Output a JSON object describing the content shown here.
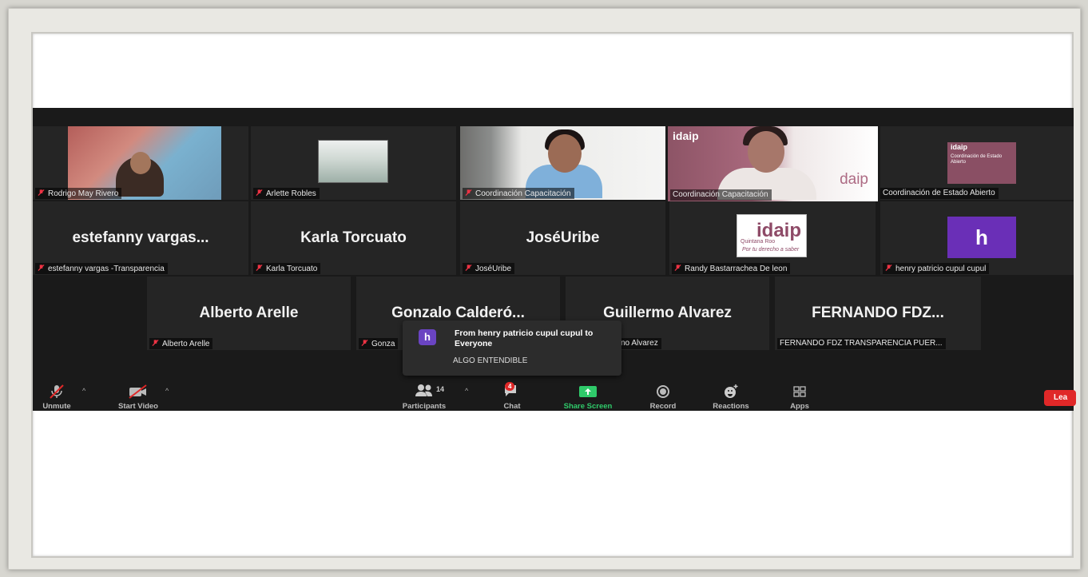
{
  "tiles": [
    {
      "name": "Rodrigo May Rivero"
    },
    {
      "name": "Arlette Robles"
    },
    {
      "name": "Coordinación Capacitación"
    },
    {
      "name": "Coordinación Capacitación"
    },
    {
      "name": "Coordinación de Estado Abierto"
    },
    {
      "big": "estefanny  vargas...",
      "name": "estefanny vargas -Transparencia"
    },
    {
      "big": "Karla Torcuato",
      "name": "Karla Torcuato"
    },
    {
      "big": "JoséUribe",
      "name": "JoséUribe"
    },
    {
      "name": "Randy Bastarrachea De leon"
    },
    {
      "name": "henry patricio cupul cupul"
    },
    {
      "big": "Alberto Arelle",
      "name": "Alberto Arelle"
    },
    {
      "big": "Gonzalo  Calderó...",
      "name": "Gonza"
    },
    {
      "big": "Guillermo Alvarez",
      "name": "no Alvarez"
    },
    {
      "big": "FERNANDO  FDZ...",
      "name": "FERNANDO FDZ TRANSPARENCIA PUER..."
    }
  ],
  "logos": {
    "idaip": "idaip",
    "idaip_bg": "daip",
    "estado_title": "idaip",
    "estado_text": "Coordinación de Estado Abierto",
    "randy_logo": "idaip",
    "randy_sub": "Quintana Roo",
    "randy_tag": "Por tu derecho a saber"
  },
  "avatar_letter": "h",
  "chat_popup": {
    "avatar": "h",
    "from": "From henry patricio cupul cupul to Everyone",
    "message": "ALGO ENTENDIBLE"
  },
  "toolbar": {
    "unmute": "Unmute",
    "start_video": "Start Video",
    "participants": "Participants",
    "participants_count": "14",
    "chat": "Chat",
    "chat_badge": "4",
    "share_screen": "Share Screen",
    "record": "Record",
    "reactions": "Reactions",
    "apps": "Apps",
    "leave": "Lea"
  },
  "colors": {
    "active_speaker": "#b9d33a",
    "share_green": "#2fca6a",
    "leave_red": "#e02828",
    "avatar_purple": "#6a2fb7"
  }
}
